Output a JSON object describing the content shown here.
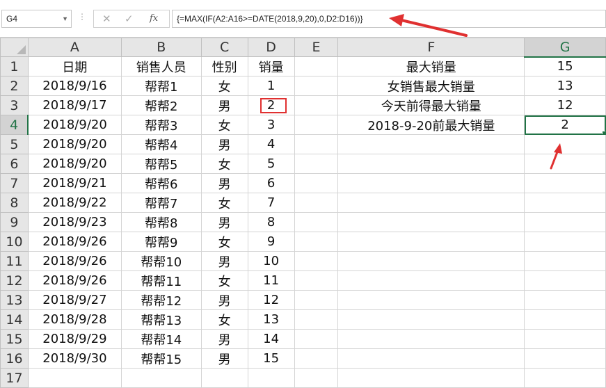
{
  "formula_bar": {
    "name_box": "G4",
    "cancel_icon": "✕",
    "enter_icon": "✓",
    "fx_label": "fx",
    "formula": "{=MAX(IF(A2:A16>=DATE(2018,9,20),0,D2:D16))}"
  },
  "sheet": {
    "columns": [
      "A",
      "B",
      "C",
      "D",
      "E",
      "F",
      "G"
    ],
    "selected_column": "G",
    "active_cell": "G4",
    "highlighted_cell": "D3",
    "rows": [
      {
        "n": "1",
        "A": "日期",
        "B": "销售人员",
        "C": "性别",
        "D": "销量",
        "E": "",
        "F": "最大销量",
        "G": "15"
      },
      {
        "n": "2",
        "A": "2018/9/16",
        "B": "帮帮1",
        "C": "女",
        "D": "1",
        "E": "",
        "F": "女销售最大销量",
        "G": "13"
      },
      {
        "n": "3",
        "A": "2018/9/17",
        "B": "帮帮2",
        "C": "男",
        "D": "2",
        "E": "",
        "F": "今天前得最大销量",
        "G": "12"
      },
      {
        "n": "4",
        "A": "2018/9/20",
        "B": "帮帮3",
        "C": "女",
        "D": "3",
        "E": "",
        "F": "2018-9-20前最大销量",
        "G": "2"
      },
      {
        "n": "5",
        "A": "2018/9/20",
        "B": "帮帮4",
        "C": "男",
        "D": "4",
        "E": "",
        "F": "",
        "G": ""
      },
      {
        "n": "6",
        "A": "2018/9/20",
        "B": "帮帮5",
        "C": "女",
        "D": "5",
        "E": "",
        "F": "",
        "G": ""
      },
      {
        "n": "7",
        "A": "2018/9/21",
        "B": "帮帮6",
        "C": "男",
        "D": "6",
        "E": "",
        "F": "",
        "G": ""
      },
      {
        "n": "8",
        "A": "2018/9/22",
        "B": "帮帮7",
        "C": "女",
        "D": "7",
        "E": "",
        "F": "",
        "G": ""
      },
      {
        "n": "9",
        "A": "2018/9/23",
        "B": "帮帮8",
        "C": "男",
        "D": "8",
        "E": "",
        "F": "",
        "G": ""
      },
      {
        "n": "10",
        "A": "2018/9/26",
        "B": "帮帮9",
        "C": "女",
        "D": "9",
        "E": "",
        "F": "",
        "G": ""
      },
      {
        "n": "11",
        "A": "2018/9/26",
        "B": "帮帮10",
        "C": "男",
        "D": "10",
        "E": "",
        "F": "",
        "G": ""
      },
      {
        "n": "12",
        "A": "2018/9/26",
        "B": "帮帮11",
        "C": "女",
        "D": "11",
        "E": "",
        "F": "",
        "G": ""
      },
      {
        "n": "13",
        "A": "2018/9/27",
        "B": "帮帮12",
        "C": "男",
        "D": "12",
        "E": "",
        "F": "",
        "G": ""
      },
      {
        "n": "14",
        "A": "2018/9/28",
        "B": "帮帮13",
        "C": "女",
        "D": "13",
        "E": "",
        "F": "",
        "G": ""
      },
      {
        "n": "15",
        "A": "2018/9/29",
        "B": "帮帮14",
        "C": "男",
        "D": "14",
        "E": "",
        "F": "",
        "G": ""
      },
      {
        "n": "16",
        "A": "2018/9/30",
        "B": "帮帮15",
        "C": "男",
        "D": "15",
        "E": "",
        "F": "",
        "G": ""
      },
      {
        "n": "17",
        "A": "",
        "B": "",
        "C": "",
        "D": "",
        "E": "",
        "F": "",
        "G": ""
      }
    ]
  },
  "colors": {
    "accent_green": "#217346",
    "annotation_red": "#e03030"
  }
}
